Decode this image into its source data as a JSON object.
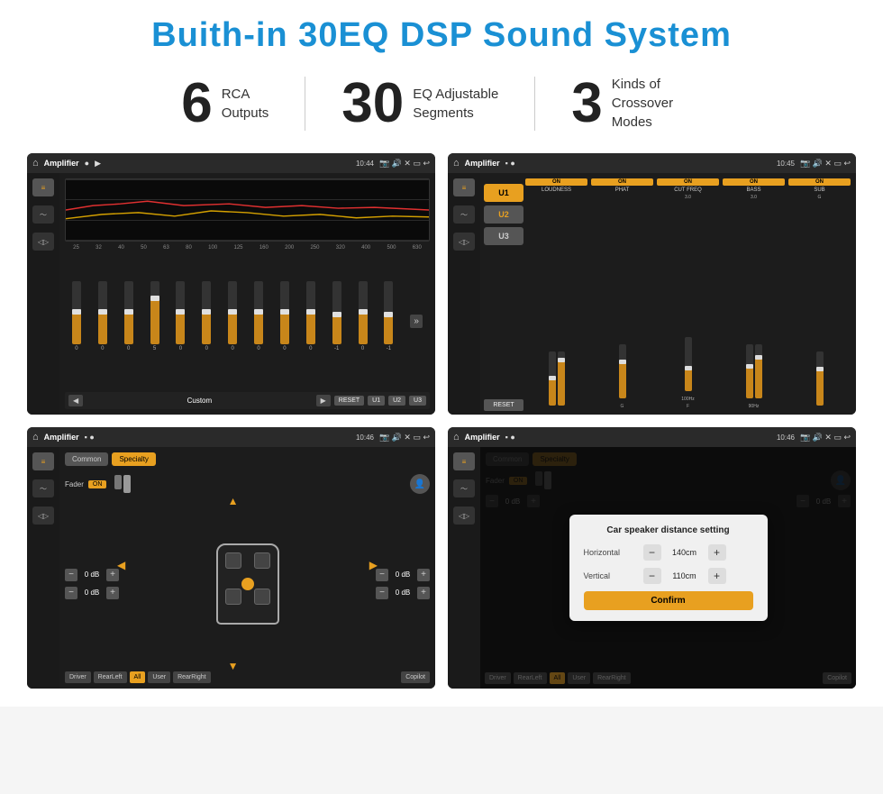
{
  "title": "Buith-in 30EQ DSP Sound System",
  "stats": [
    {
      "number": "6",
      "label": "RCA\nOutputs"
    },
    {
      "number": "30",
      "label": "EQ Adjustable\nSegments"
    },
    {
      "number": "3",
      "label": "Kinds of\nCrossover Modes"
    }
  ],
  "screens": {
    "eq": {
      "topbar": {
        "title": "Amplifier",
        "time": "10:44"
      },
      "bands": [
        "25",
        "32",
        "40",
        "50",
        "63",
        "80",
        "100",
        "125",
        "160",
        "200",
        "250",
        "320",
        "400",
        "500",
        "630"
      ],
      "values": [
        "0",
        "0",
        "0",
        "5",
        "0",
        "0",
        "0",
        "0",
        "0",
        "0",
        "-1",
        "0",
        "-1"
      ],
      "preset": "Custom",
      "buttons": [
        "RESET",
        "U1",
        "U2",
        "U3"
      ]
    },
    "crossover": {
      "topbar": {
        "title": "Amplifier",
        "time": "10:45"
      },
      "channels": [
        "LOUDNESS",
        "PHAT",
        "CUT FREQ",
        "BASS",
        "SUB"
      ],
      "uButtons": [
        "U1",
        "U2",
        "U3"
      ],
      "resetLabel": "RESET"
    },
    "speaker": {
      "topbar": {
        "title": "Amplifier",
        "time": "10:46"
      },
      "tabs": [
        "Common",
        "Specialty"
      ],
      "faderLabel": "Fader",
      "faderOn": "ON",
      "dbValues": [
        "0 dB",
        "0 dB",
        "0 dB",
        "0 dB"
      ],
      "bottomButtons": [
        "Driver",
        "RearLeft",
        "All",
        "User",
        "RearRight",
        "Copilot"
      ]
    },
    "dialog": {
      "topbar": {
        "title": "Amplifier",
        "time": "10:46"
      },
      "tabs": [
        "Common",
        "Specialty"
      ],
      "dialogTitle": "Car speaker distance setting",
      "horizontalLabel": "Horizontal",
      "horizontalValue": "140cm",
      "verticalLabel": "Vertical",
      "verticalValue": "110cm",
      "confirmLabel": "Confirm",
      "dbValues": [
        "0 dB",
        "0 dB"
      ]
    }
  }
}
